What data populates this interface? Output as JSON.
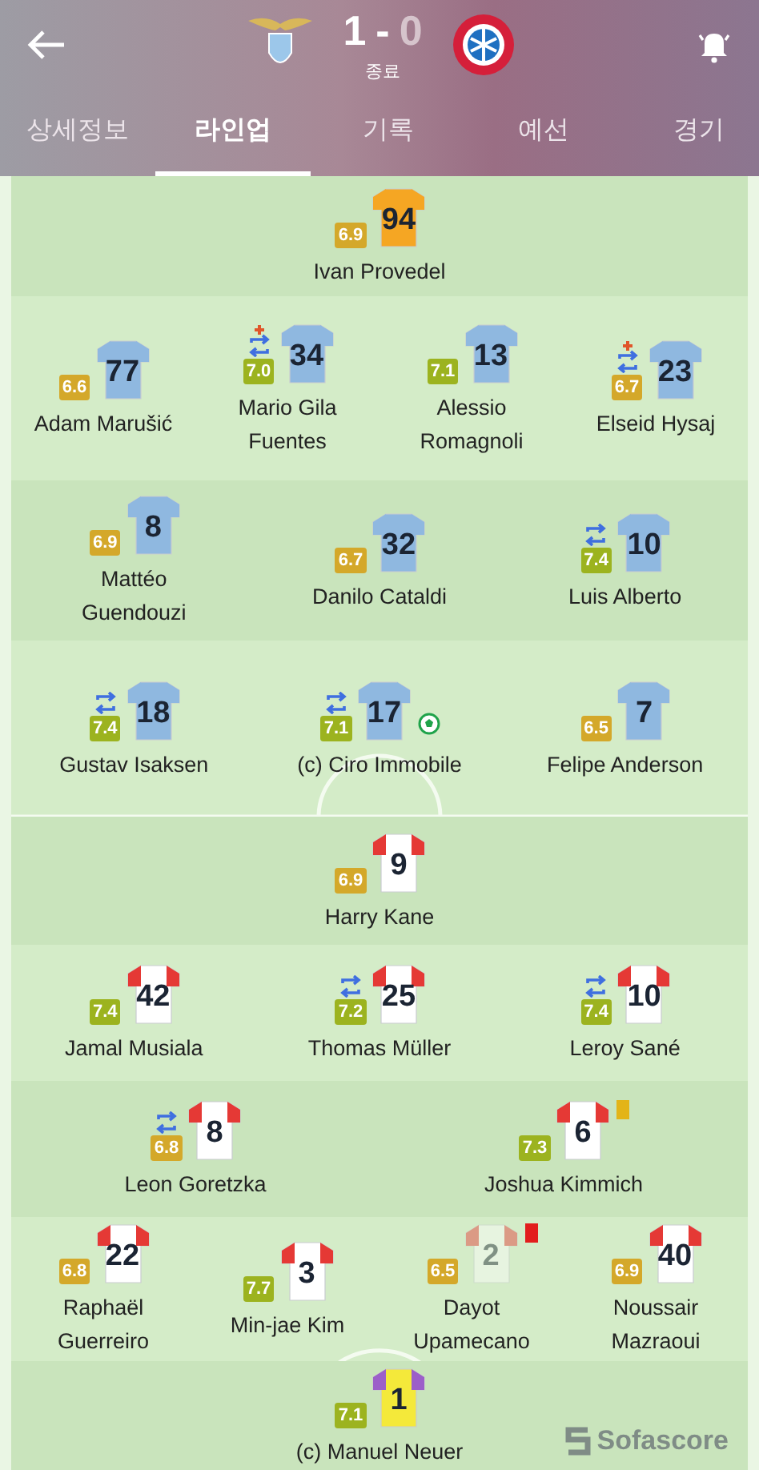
{
  "header": {
    "score_home": "1",
    "score_separator": "-",
    "score_away": "0",
    "status": "종료"
  },
  "tabs": [
    {
      "label": "상세정보",
      "selected": false
    },
    {
      "label": "라인업",
      "selected": true
    },
    {
      "label": "기록",
      "selected": false
    },
    {
      "label": "예선",
      "selected": false
    },
    {
      "label": "경기",
      "selected": false
    }
  ],
  "lineup_rows": [
    {
      "players": [
        {
          "name": "Ivan Provedel",
          "number": "94",
          "rating": "6.9",
          "color": "#d4a82a",
          "kind": "lazio-gk",
          "substituted": false,
          "injured": false,
          "goal": false,
          "booked": false,
          "sent_off": false
        }
      ]
    },
    {
      "players": [
        {
          "name": "Adam Marušić",
          "number": "77",
          "rating": "6.6",
          "color": "#d4a82a",
          "kind": "lazio",
          "substituted": false,
          "injured": false,
          "goal": false,
          "booked": false,
          "sent_off": false
        },
        {
          "name": "Mario Gila Fuentes",
          "number": "34",
          "rating": "7.0",
          "color": "#9cb31f",
          "kind": "lazio",
          "substituted": true,
          "injured": true,
          "goal": false,
          "booked": false,
          "sent_off": false
        },
        {
          "name": "Alessio Romagnoli",
          "number": "13",
          "rating": "7.1",
          "color": "#9cb31f",
          "kind": "lazio",
          "substituted": false,
          "injured": false,
          "goal": false,
          "booked": false,
          "sent_off": false
        },
        {
          "name": "Elseid Hysaj",
          "number": "23",
          "rating": "6.7",
          "color": "#d4a82a",
          "kind": "lazio",
          "substituted": true,
          "injured": true,
          "goal": false,
          "booked": false,
          "sent_off": false
        }
      ]
    },
    {
      "players": [
        {
          "name": "Mattéo Guendouzi",
          "number": "8",
          "rating": "6.9",
          "color": "#d4a82a",
          "kind": "lazio",
          "substituted": false,
          "injured": false,
          "goal": false,
          "booked": false,
          "sent_off": false
        },
        {
          "name": "Danilo Cataldi",
          "number": "32",
          "rating": "6.7",
          "color": "#d4a82a",
          "kind": "lazio",
          "substituted": false,
          "injured": false,
          "goal": false,
          "booked": false,
          "sent_off": false
        },
        {
          "name": "Luis Alberto",
          "number": "10",
          "rating": "7.4",
          "color": "#9cb31f",
          "kind": "lazio",
          "substituted": true,
          "injured": false,
          "goal": false,
          "booked": false,
          "sent_off": false
        }
      ]
    },
    {
      "players": [
        {
          "name": "Gustav Isaksen",
          "number": "18",
          "rating": "7.4",
          "color": "#9cb31f",
          "kind": "lazio",
          "substituted": true,
          "injured": false,
          "goal": false,
          "booked": false,
          "sent_off": false
        },
        {
          "name": "(c) Ciro Immobile",
          "number": "17",
          "rating": "7.1",
          "color": "#9cb31f",
          "kind": "lazio",
          "substituted": true,
          "injured": false,
          "goal": true,
          "booked": false,
          "sent_off": false
        },
        {
          "name": "Felipe Anderson",
          "number": "7",
          "rating": "6.5",
          "color": "#d4a82a",
          "kind": "lazio",
          "substituted": false,
          "injured": false,
          "goal": false,
          "booked": false,
          "sent_off": false
        }
      ]
    },
    {
      "players": [
        {
          "name": "Harry Kane",
          "number": "9",
          "rating": "6.9",
          "color": "#d4a82a",
          "kind": "bayern",
          "substituted": false,
          "injured": false,
          "goal": false,
          "booked": false,
          "sent_off": false
        }
      ]
    },
    {
      "players": [
        {
          "name": "Jamal Musiala",
          "number": "42",
          "rating": "7.4",
          "color": "#9cb31f",
          "kind": "bayern",
          "substituted": false,
          "injured": false,
          "goal": false,
          "booked": false,
          "sent_off": false
        },
        {
          "name": "Thomas Müller",
          "number": "25",
          "rating": "7.2",
          "color": "#9cb31f",
          "kind": "bayern",
          "substituted": true,
          "injured": false,
          "goal": false,
          "booked": false,
          "sent_off": false
        },
        {
          "name": "Leroy Sané",
          "number": "10",
          "rating": "7.4",
          "color": "#9cb31f",
          "kind": "bayern",
          "substituted": true,
          "injured": false,
          "goal": false,
          "booked": false,
          "sent_off": false
        }
      ]
    },
    {
      "players": [
        {
          "name": "Leon Goretzka",
          "number": "8",
          "rating": "6.8",
          "color": "#d4a82a",
          "kind": "bayern",
          "substituted": true,
          "injured": false,
          "goal": false,
          "booked": false,
          "sent_off": false
        },
        {
          "name": "Joshua Kimmich",
          "number": "6",
          "rating": "7.3",
          "color": "#9cb31f",
          "kind": "bayern",
          "substituted": false,
          "injured": false,
          "goal": false,
          "booked": true,
          "sent_off": false
        }
      ]
    },
    {
      "players": [
        {
          "name": "Raphaël Guerreiro",
          "number": "22",
          "rating": "6.8",
          "color": "#d4a82a",
          "kind": "bayern",
          "substituted": false,
          "injured": false,
          "goal": false,
          "booked": false,
          "sent_off": false
        },
        {
          "name": "Min-jae Kim",
          "number": "3",
          "rating": "7.7",
          "color": "#9cb31f",
          "kind": "bayern",
          "substituted": false,
          "injured": false,
          "goal": false,
          "booked": false,
          "sent_off": false
        },
        {
          "name": "Dayot Upamecano",
          "number": "2",
          "rating": "6.5",
          "color": "#d4a82a",
          "kind": "bayern",
          "substituted": false,
          "injured": false,
          "goal": false,
          "booked": false,
          "sent_off": true
        },
        {
          "name": "Noussair Mazraoui",
          "number": "40",
          "rating": "6.9",
          "color": "#d4a82a",
          "kind": "bayern",
          "substituted": false,
          "injured": false,
          "goal": false,
          "booked": false,
          "sent_off": false
        }
      ]
    },
    {
      "players": [
        {
          "name": "(c) Manuel Neuer",
          "number": "1",
          "rating": "7.1",
          "color": "#9cb31f",
          "kind": "bayern-gk",
          "substituted": false,
          "injured": false,
          "goal": false,
          "booked": false,
          "sent_off": false
        }
      ]
    }
  ],
  "branding": "Sofascore"
}
